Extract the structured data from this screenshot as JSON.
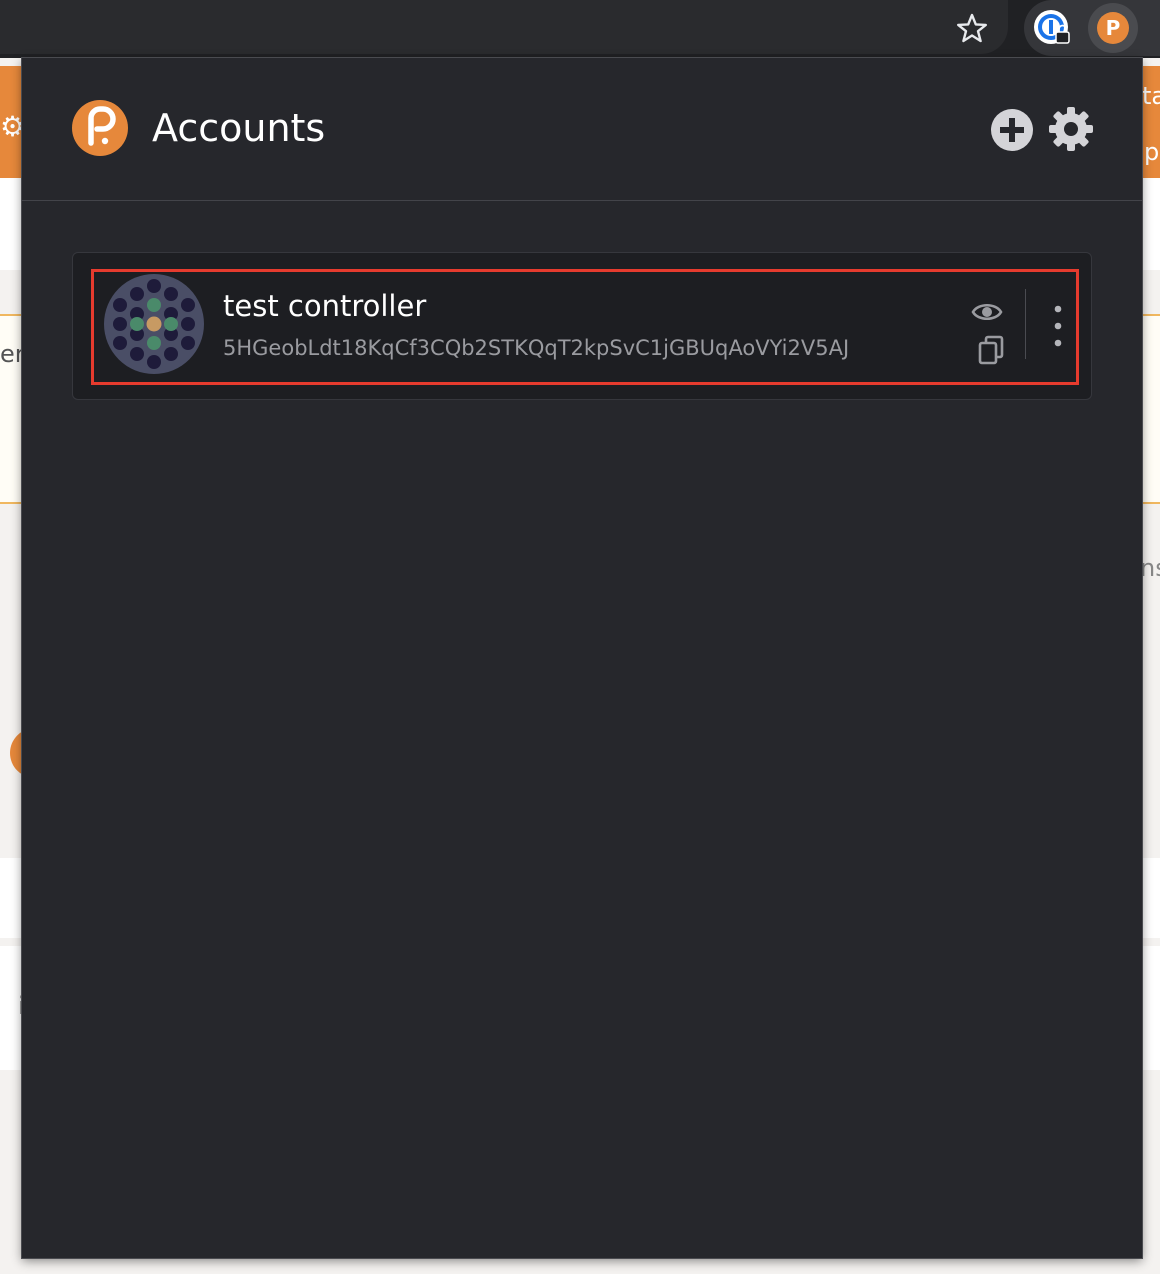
{
  "browser": {
    "bookmark_icon": "star-outline-icon",
    "extensions": [
      {
        "name": "password-manager-icon"
      },
      {
        "name": "polkadot-js-extension-icon",
        "glyph": "P"
      }
    ]
  },
  "background_page": {
    "fragments": [
      "er",
      "ta",
      "p",
      "ns",
      "i"
    ]
  },
  "popup": {
    "logo_glyph": "P",
    "title": "Accounts",
    "actions": [
      "add-account",
      "settings"
    ],
    "accent_color": "#e6883b",
    "accounts": [
      {
        "name": "test controller",
        "address": "5HGeobLdt18KqCf3CQb2STKQqT2kpSvC1jGBUqAoVYi2V5AJ",
        "highlight_color": "#e63b2e"
      }
    ]
  }
}
